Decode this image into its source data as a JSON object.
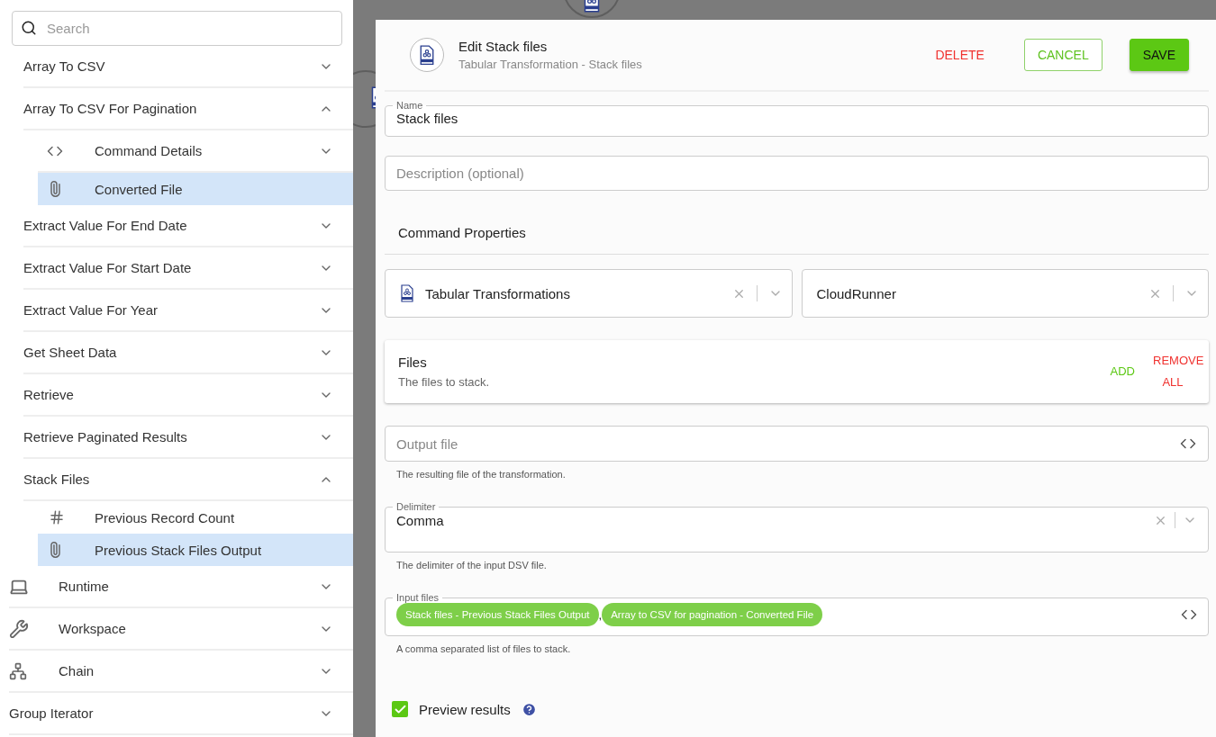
{
  "sidebar": {
    "search": {
      "placeholder": "Search"
    },
    "commands": [
      {
        "label": "Array To CSV",
        "expanded": false
      },
      {
        "label": "Array To CSV For Pagination",
        "expanded": true,
        "children": [
          {
            "label": "Command Details",
            "kind": "command",
            "expandable": true,
            "selected": false
          },
          {
            "label": "Converted File",
            "kind": "attachment",
            "expandable": false,
            "selected": true
          }
        ]
      },
      {
        "label": "Extract Value For End Date",
        "expanded": false
      },
      {
        "label": "Extract Value For Start Date",
        "expanded": false
      },
      {
        "label": "Extract Value For Year",
        "expanded": false
      },
      {
        "label": "Get Sheet Data",
        "expanded": false
      },
      {
        "label": "Retrieve",
        "expanded": false
      },
      {
        "label": "Retrieve Paginated Results",
        "expanded": false
      },
      {
        "label": "Stack Files",
        "expanded": true,
        "children": [
          {
            "label": "Previous Record Count",
            "kind": "count",
            "expandable": false,
            "selected": false
          },
          {
            "label": "Previous Stack Files Output",
            "kind": "attachment",
            "expandable": false,
            "selected": true
          }
        ]
      }
    ],
    "sections": [
      {
        "label": "Runtime",
        "kind": "runtime",
        "expanded": false
      },
      {
        "label": "Workspace",
        "kind": "workspace",
        "expanded": false
      },
      {
        "label": "Chain",
        "kind": "chain",
        "expanded": false
      },
      {
        "label": "Group Iterator",
        "kind": "group",
        "expanded": false
      }
    ]
  },
  "modal": {
    "title": "Edit Stack files",
    "subtitle": "Tabular Transformation - Stack files",
    "buttons": [
      {
        "label": "DELETE",
        "kind": "danger"
      },
      {
        "label": "CANCEL",
        "kind": "outline"
      },
      {
        "label": "SAVE",
        "kind": "primary"
      }
    ],
    "name_field": {
      "label": "Name",
      "value": "Stack files"
    },
    "description_field": {
      "placeholder": "Description (optional)"
    },
    "section_title": "Command Properties",
    "selects": [
      {
        "value": "Tabular Transformations",
        "kind": "with-icon"
      },
      {
        "value": "CloudRunner",
        "kind": "plain"
      }
    ],
    "files": {
      "title": "Files",
      "description": "The files to stack.",
      "add": "ADD",
      "remove_all": "REMOVE ALL"
    },
    "output_file": {
      "placeholder": "Output file",
      "help": "The resulting file of the transformation."
    },
    "delimiter": {
      "label": "Delimiter",
      "value": "Comma",
      "help": "The delimiter of the input DSV file."
    },
    "input_files": {
      "label": "Input files",
      "chips": [
        "Stack files - Previous Stack Files Output",
        "Array to CSV for pagination - Converted File"
      ],
      "separator": ",",
      "help": "A comma separated list of files to stack."
    },
    "preview": {
      "label": "Preview results",
      "checked": true
    }
  }
}
